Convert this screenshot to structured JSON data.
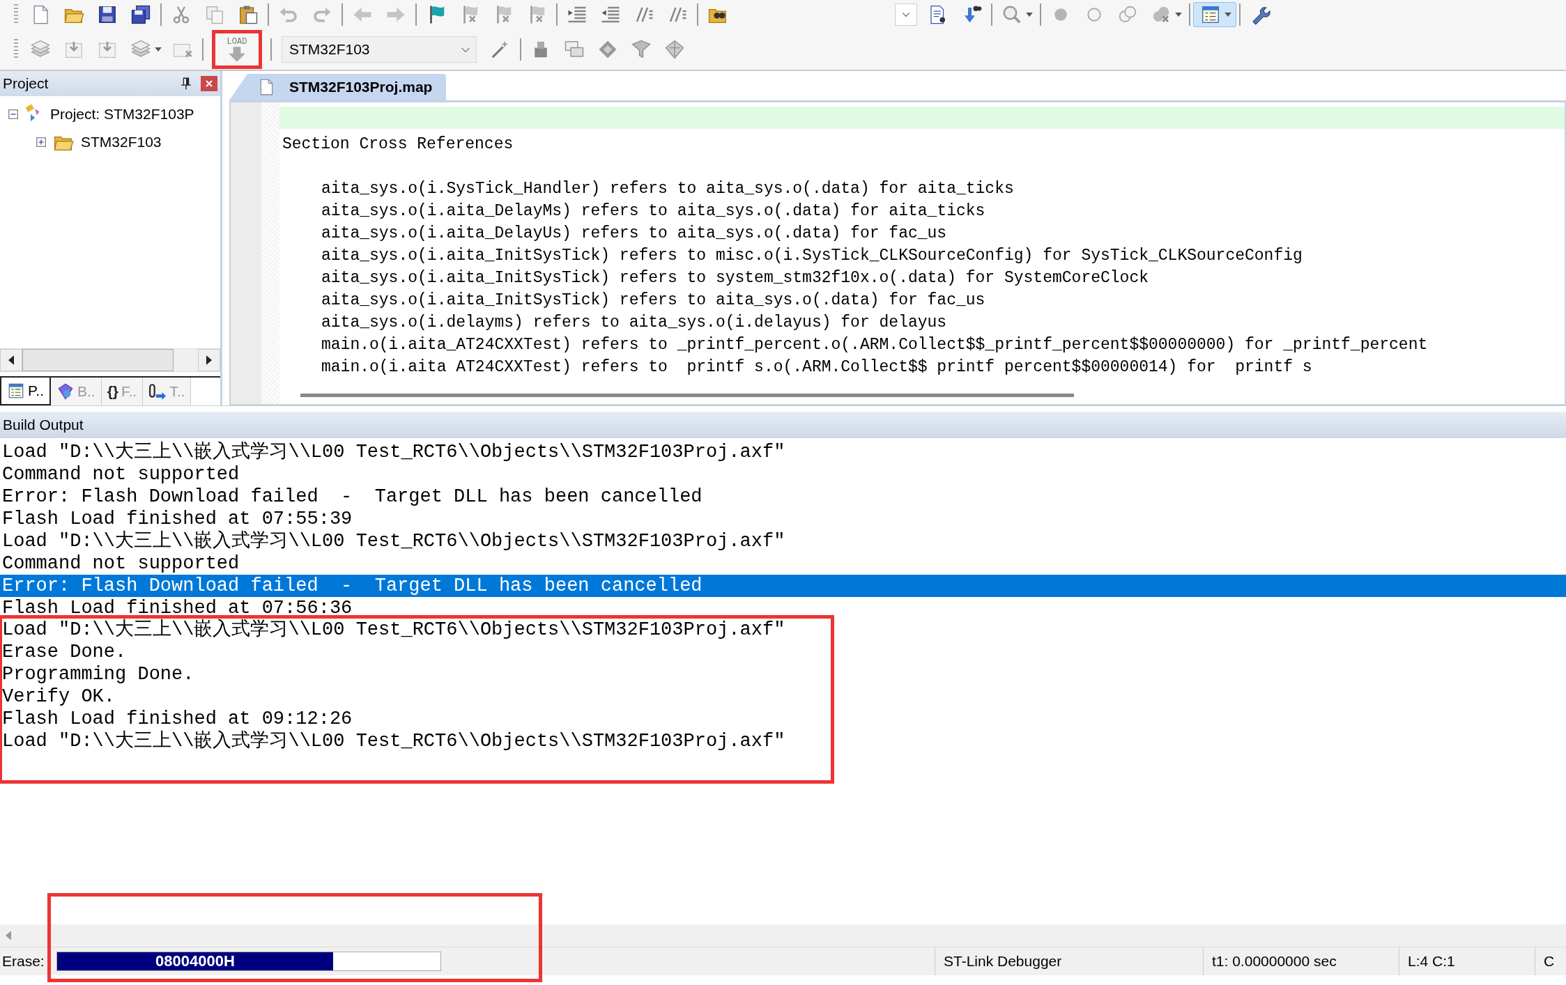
{
  "toolbar": {
    "load_button": {
      "label": "LOAD",
      "framed": true
    },
    "target_select": {
      "value": "STM32F103"
    }
  },
  "project_panel": {
    "title": "Project",
    "tree": [
      {
        "label": "Project: STM32F103P",
        "expanded": true,
        "children": [
          {
            "label": "STM32F103",
            "expanded": false
          }
        ]
      }
    ],
    "tabs": [
      {
        "label": "P..",
        "selected": true
      },
      {
        "label": "B..",
        "selected": false
      },
      {
        "glyph": "{}",
        "label": "F..",
        "selected": false
      },
      {
        "label": "T..",
        "selected": false
      }
    ]
  },
  "editor": {
    "tabs": [
      {
        "label": "STM32F103Proj.map",
        "selected": true
      }
    ],
    "lines": [
      {
        "kind": "heading",
        "text": "Section Cross References"
      },
      {
        "kind": "entry",
        "text": "aita_sys.o(i.SysTick_Handler) refers to aita_sys.o(.data) for aita_ticks"
      },
      {
        "kind": "entry",
        "text": "aita_sys.o(i.aita_DelayMs) refers to aita_sys.o(.data) for aita_ticks"
      },
      {
        "kind": "entry",
        "text": "aita_sys.o(i.aita_DelayUs) refers to aita_sys.o(.data) for fac_us"
      },
      {
        "kind": "entry",
        "text": "aita_sys.o(i.aita_InitSysTick) refers to misc.o(i.SysTick_CLKSourceConfig) for SysTick_CLKSourceConfig"
      },
      {
        "kind": "entry",
        "text": "aita_sys.o(i.aita_InitSysTick) refers to system_stm32f10x.o(.data) for SystemCoreClock"
      },
      {
        "kind": "entry",
        "text": "aita_sys.o(i.aita_InitSysTick) refers to aita_sys.o(.data) for fac_us"
      },
      {
        "kind": "entry",
        "text": "aita_sys.o(i.delayms) refers to aita_sys.o(i.delayus) for delayus"
      },
      {
        "kind": "entry",
        "text": "main.o(i.aita_AT24CXXTest) refers to _printf_percent.o(.ARM.Collect$$_printf_percent$$00000000) for _printf_percent"
      },
      {
        "kind": "entry",
        "text": "main.o(i.aita AT24CXXTest) refers to  printf s.o(.ARM.Collect$$ printf percent$$00000014) for  printf s"
      }
    ]
  },
  "build_output": {
    "title": "Build Output",
    "lines": [
      {
        "text": "Load \"D:\\\\大三上\\\\嵌入式学习\\\\L00 Test_RCT6\\\\Objects\\\\STM32F103Proj.axf\"",
        "selected": false
      },
      {
        "text": "Command not supported",
        "selected": false
      },
      {
        "text": "Error: Flash Download failed  -  Target DLL has been cancelled",
        "selected": false
      },
      {
        "text": "Flash Load finished at 07:55:39",
        "selected": false
      },
      {
        "text": "Load \"D:\\\\大三上\\\\嵌入式学习\\\\L00 Test_RCT6\\\\Objects\\\\STM32F103Proj.axf\"",
        "selected": false
      },
      {
        "text": "Command not supported",
        "selected": false
      },
      {
        "text": "Error: Flash Download failed  -  Target DLL has been cancelled",
        "selected": true
      },
      {
        "text": "Flash Load finished at 07:56:36",
        "selected": false
      }
    ],
    "framed_lines": [
      {
        "text": "Load \"D:\\\\大三上\\\\嵌入式学习\\\\L00 Test_RCT6\\\\Objects\\\\STM32F103Proj.axf\"",
        "selected": false
      },
      {
        "text": "Erase Done.",
        "selected": false
      },
      {
        "text": "Programming Done.",
        "selected": false
      },
      {
        "text": "Verify OK.",
        "selected": false
      },
      {
        "text": "Flash Load finished at 09:12:26",
        "selected": false
      },
      {
        "text": "Load \"D:\\\\大三上\\\\嵌入式学习\\\\L00 Test_RCT6\\\\Objects\\\\STM32F103Proj.axf\"",
        "selected": false
      }
    ]
  },
  "status_bar": {
    "framed": true,
    "erase_label": "Erase:",
    "progress": {
      "level": 0.72,
      "text": "08004000H"
    },
    "debugger": "ST-Link Debugger",
    "time": "t1: 0.00000000 sec",
    "cursor": "L:4 C:1",
    "extra": "C"
  }
}
